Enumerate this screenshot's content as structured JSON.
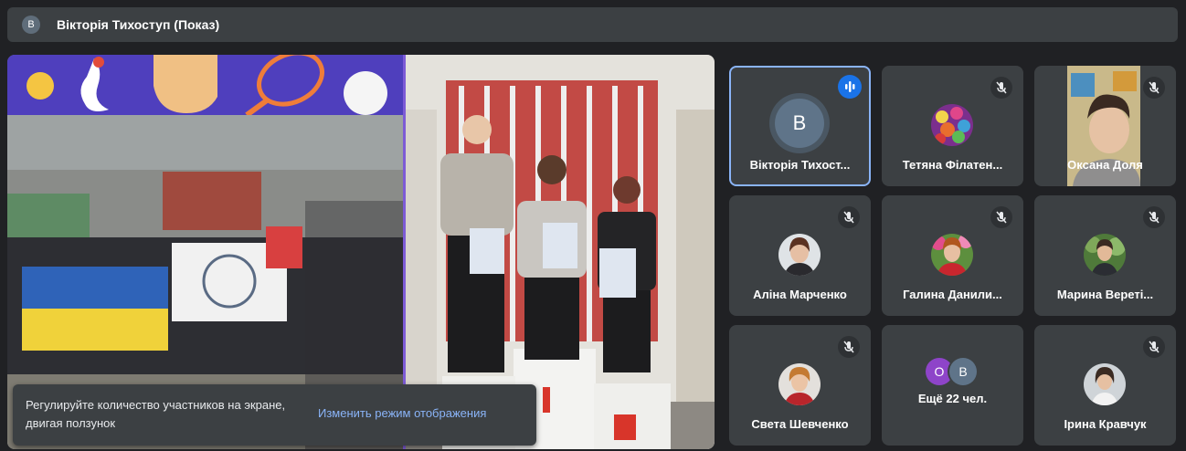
{
  "header": {
    "avatar_letter": "В",
    "title": "Вікторія Тихоступ (Показ)"
  },
  "toast": {
    "message": "Регулируйте количество участников на экране, двигая ползунок",
    "action": "Изменить режим отображения"
  },
  "participants": [
    {
      "name": "Вікторія Тихост...",
      "initial": "В",
      "speaking": true
    },
    {
      "name": "Тетяна Філатен...",
      "muted": true
    },
    {
      "name": "Оксана Доля",
      "muted": true
    },
    {
      "name": "Аліна Марченко",
      "muted": true
    },
    {
      "name": "Галина Данили...",
      "muted": true
    },
    {
      "name": "Марина Вереті...",
      "muted": true
    },
    {
      "name": "Света Шевченко",
      "muted": true
    },
    {
      "name": "Ещё 22 чел.",
      "initials": [
        "О",
        "В"
      ]
    },
    {
      "name": "Ірина Кравчук",
      "muted": true
    }
  ],
  "colors": {
    "background": "#202124",
    "tile": "#3c4043",
    "accent": "#8ab4f8",
    "speaking": "#1a73e8"
  }
}
